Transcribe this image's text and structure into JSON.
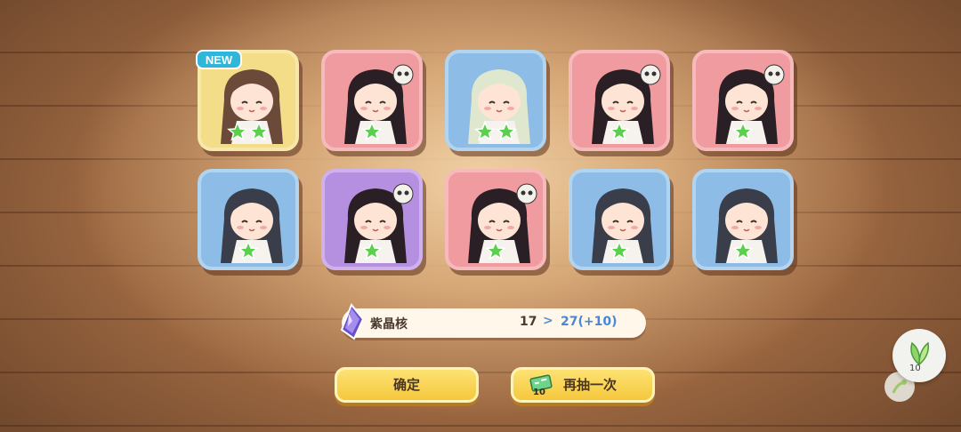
{
  "new_badge": "NEW",
  "cards": [
    {
      "color": "yellow",
      "stars": 2,
      "character": "headband-girl-icon"
    },
    {
      "color": "pink",
      "stars": 1,
      "character": "skull-girl-icon"
    },
    {
      "color": "blue",
      "stars": 2,
      "character": "white-hair-girl-icon"
    },
    {
      "color": "pink",
      "stars": 1,
      "character": "skull-girl-icon"
    },
    {
      "color": "pink",
      "stars": 1,
      "character": "skull-girl-icon"
    },
    {
      "color": "blue",
      "stars": 1,
      "character": "bowl-girl-icon"
    },
    {
      "color": "purple",
      "stars": 1,
      "character": "skull-girl-purple-icon"
    },
    {
      "color": "pink",
      "stars": 1,
      "character": "skull-girl-icon"
    },
    {
      "color": "blue",
      "stars": 1,
      "character": "bowl-girl-icon"
    },
    {
      "color": "blue",
      "stars": 1,
      "character": "bowl-girl-icon"
    }
  ],
  "resource": {
    "name": "紫晶核",
    "old_value": "17",
    "arrow": ">",
    "new_value": "27(+10)",
    "icon": "purple-crystal-icon"
  },
  "buttons": {
    "confirm": "确定",
    "draw_again": "再抽一次",
    "ticket_count": "10"
  },
  "side_item": {
    "count": "10",
    "icon": "leaf-item-icon"
  },
  "colors": {
    "accent": "#f5c83d",
    "new_badge": "#2fb6d9",
    "star": "#5ccf4e"
  }
}
